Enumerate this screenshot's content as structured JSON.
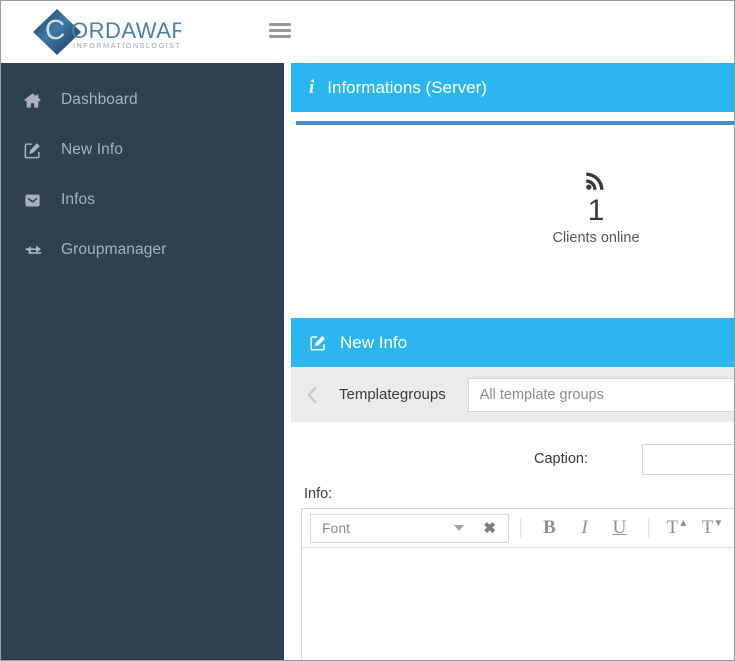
{
  "brand": {
    "name": "CORDAWARE",
    "tagline": "INFORMATIONSLOGISTIK",
    "accent_blue": "#2cb6ef",
    "sidebar_bg": "#2f4050",
    "divider_blue": "#4a8bc9"
  },
  "topbar": {
    "menu_toggle_name": "hamburger-menu"
  },
  "sidebar": {
    "items": [
      {
        "label": "Dashboard",
        "icon": "home-icon"
      },
      {
        "label": "New Info",
        "icon": "edit-square-icon"
      },
      {
        "label": "Infos",
        "icon": "envelope-icon"
      },
      {
        "label": "Groupmanager",
        "icon": "exchange-arrows-icon"
      }
    ]
  },
  "panels": {
    "server_info": {
      "title": "Informations (Server)",
      "icon": "info-icon",
      "stat": {
        "icon": "rss-signal-icon",
        "value": "1",
        "label": "Clients online"
      }
    },
    "new_info": {
      "title": "New Info",
      "icon": "edit-square-icon",
      "toolbar": {
        "back_icon": "chevron-left-icon",
        "templategroups_label": "Templategroups",
        "templategroups_value": "All template groups"
      },
      "form": {
        "caption_label": "Caption:",
        "caption_value": "",
        "caption_placeholder": "",
        "info_label": "Info:",
        "editor": {
          "font_label": "Font",
          "clear_icon": "clear-x-icon",
          "caret_icon": "chevron-down-icon",
          "bold_label": "B",
          "italic_label": "I",
          "underline_label": "U",
          "superscript_label": "T",
          "subscript_label": "T",
          "body_value": ""
        }
      }
    }
  }
}
